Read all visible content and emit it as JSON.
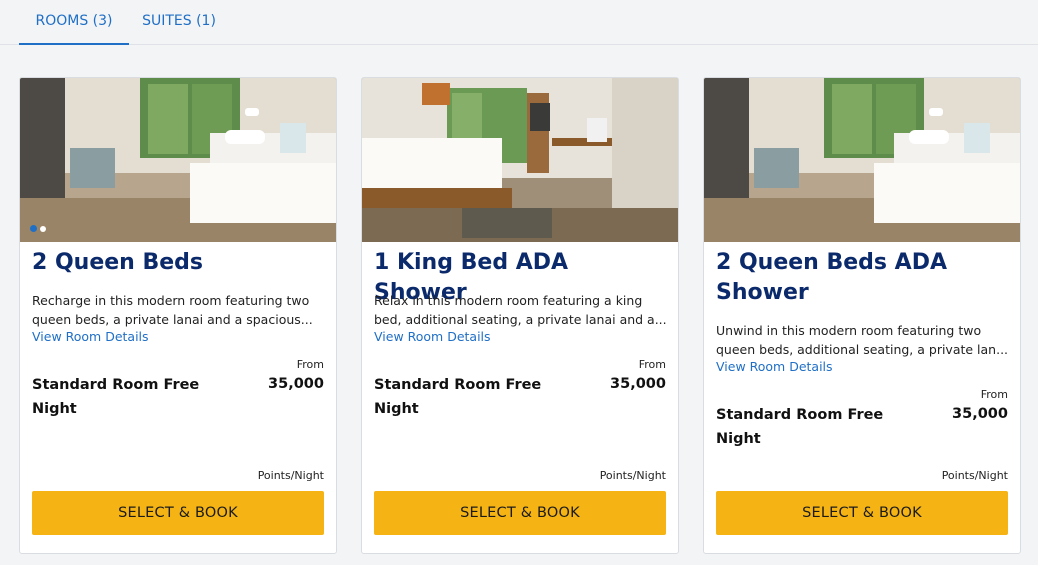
{
  "tabs": [
    {
      "label": "ROOMS (3)",
      "active": true
    },
    {
      "label": "SUITES (1)",
      "active": false
    }
  ],
  "colors": {
    "accent_blue": "#1f6fc6",
    "title_navy": "#0b2a6b",
    "button_yellow": "#f5b414"
  },
  "rooms": [
    {
      "title": "2 Queen Beds",
      "description": "Recharge in this modern room featuring two queen beds, a private lanai and a spacious...",
      "details_link": "View Room Details",
      "from_label": "From",
      "rate_name": "Standard Room Free Night",
      "points": "35,000",
      "unit_label": "Points/Night",
      "button_label": "SELECT & BOOK",
      "photo": "two-queen-beds-room-photo"
    },
    {
      "title": "1 King Bed ADA Shower",
      "description": "Relax in this modern room featuring a king bed, additional seating, a private lanai and a...",
      "details_link": "View Room Details",
      "from_label": "From",
      "rate_name": "Standard Room Free Night",
      "points": "35,000",
      "unit_label": "Points/Night",
      "button_label": "SELECT & BOOK",
      "photo": "king-bed-room-photo"
    },
    {
      "title": "2 Queen Beds ADA Shower",
      "description": "Unwind in this modern room featuring two queen beds, additional seating, a private lan...",
      "details_link": "View Room Details",
      "from_label": "From",
      "rate_name": "Standard Room Free Night",
      "points": "35,000",
      "unit_label": "Points/Night",
      "button_label": "SELECT & BOOK",
      "photo": "two-queen-beds-room-photo"
    }
  ]
}
